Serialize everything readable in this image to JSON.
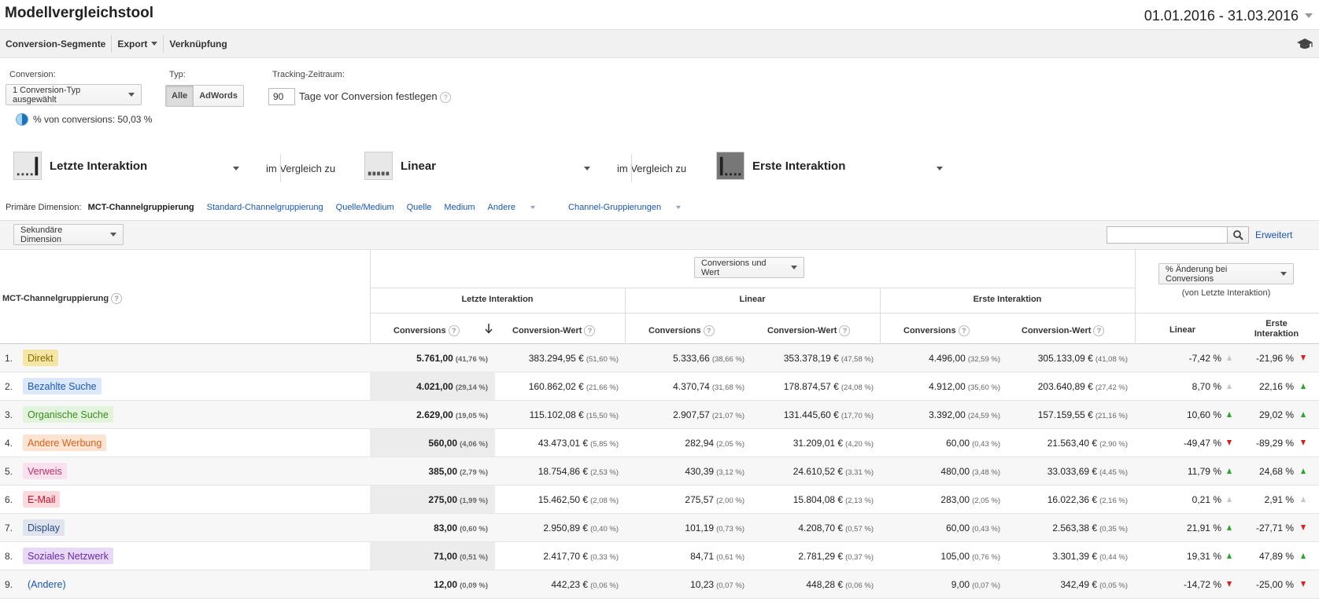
{
  "title": "Modellvergleichstool",
  "date_range": "01.01.2016 - 31.03.2016",
  "toolbar": {
    "segments": "Conversion-Segmente",
    "export": "Export",
    "link": "Verknüpfung"
  },
  "controls": {
    "conversion_label": "Conversion:",
    "conversion_value": "1 Conversion-Typ ausgewählt",
    "type_label": "Typ:",
    "type_all": "Alle",
    "type_adwords": "AdWords",
    "tracking_label": "Tracking-Zeitraum:",
    "days": "90",
    "days_text": "Tage vor Conversion festlegen",
    "pct_text": "% von conversions: 50,03 %"
  },
  "models": {
    "m1": "Letzte Interaktion",
    "m2": "Linear",
    "m3": "Erste Interaktion",
    "compare": "im Vergleich zu"
  },
  "dimensions": {
    "label": "Primäre Dimension:",
    "current": "MCT-Channelgruppierung",
    "standard": "Standard-Channelgruppierung",
    "source_medium": "Quelle/Medium",
    "source": "Quelle",
    "medium": "Medium",
    "other": "Andere",
    "channel_groups": "Channel-Gruppierungen"
  },
  "secondary_dimension": "Sekundäre Dimension",
  "advanced": "Erweitert",
  "table_header": {
    "dimension": "MCT-Channelgruppierung",
    "metric_select": "Conversions und Wert",
    "change_select": "% Änderung bei Conversions",
    "change_sub": "(von Letzte Interaktion)",
    "g1": "Letzte Interaktion",
    "g2": "Linear",
    "g3": "Erste Interaktion",
    "conversions": "Conversions",
    "value": "Conversion-Wert",
    "c_linear": "Linear",
    "c_first": "Erste Interaktion"
  },
  "rows": [
    {
      "n": "1.",
      "name": "Direkt",
      "bg": "#f5e6a6",
      "fg": "#8a6d00",
      "c1": "5.761,00",
      "p1": "(41,76 %)",
      "v1": "383.294,95 €",
      "q1": "(51,60 %)",
      "c2": "5.333,66",
      "p2": "(38,66 %)",
      "v2": "353.378,19 €",
      "q2": "(47,58 %)",
      "c3": "4.496,00",
      "p3": "(32,59 %)",
      "v3": "305.133,09 €",
      "q3": "(41,08 %)",
      "d1": "-7,42 %",
      "a1": "neutral",
      "d2": "-21,96 %",
      "a2": "down"
    },
    {
      "n": "2.",
      "name": "Bezahlte Suche",
      "bg": "#dbe8fb",
      "fg": "#1a56b8",
      "c1": "4.021,00",
      "p1": "(29,14 %)",
      "v1": "160.862,02 €",
      "q1": "(21,66 %)",
      "c2": "4.370,74",
      "p2": "(31,68 %)",
      "v2": "178.874,57 €",
      "q2": "(24,08 %)",
      "c3": "4.912,00",
      "p3": "(35,60 %)",
      "v3": "203.640,89 €",
      "q3": "(27,42 %)",
      "d1": "8,70 %",
      "a1": "neutral",
      "d2": "22,16 %",
      "a2": "up"
    },
    {
      "n": "3.",
      "name": "Organische Suche",
      "bg": "#e3f4dc",
      "fg": "#3a8a21",
      "c1": "2.629,00",
      "p1": "(19,05 %)",
      "v1": "115.102,08 €",
      "q1": "(15,50 %)",
      "c2": "2.907,57",
      "p2": "(21,07 %)",
      "v2": "131.445,60 €",
      "q2": "(17,70 %)",
      "c3": "3.392,00",
      "p3": "(24,59 %)",
      "v3": "157.159,55 €",
      "q3": "(21,16 %)",
      "d1": "10,60 %",
      "a1": "up",
      "d2": "29,02 %",
      "a2": "up"
    },
    {
      "n": "4.",
      "name": "Andere Werbung",
      "bg": "#fde4d2",
      "fg": "#d9621c",
      "c1": "560,00",
      "p1": "(4,06 %)",
      "v1": "43.473,01 €",
      "q1": "(5,85 %)",
      "c2": "282,94",
      "p2": "(2,05 %)",
      "v2": "31.209,01 €",
      "q2": "(4,20 %)",
      "c3": "60,00",
      "p3": "(0,43 %)",
      "v3": "21.563,40 €",
      "q3": "(2,90 %)",
      "d1": "-49,47 %",
      "a1": "down",
      "d2": "-89,29 %",
      "a2": "down"
    },
    {
      "n": "5.",
      "name": "Verweis",
      "bg": "#fbe1ee",
      "fg": "#b0326a",
      "c1": "385,00",
      "p1": "(2,79 %)",
      "v1": "18.754,86 €",
      "q1": "(2,53 %)",
      "c2": "430,39",
      "p2": "(3,12 %)",
      "v2": "24.610,52 €",
      "q2": "(3,31 %)",
      "c3": "480,00",
      "p3": "(3,48 %)",
      "v3": "33.033,69 €",
      "q3": "(4,45 %)",
      "d1": "11,79 %",
      "a1": "up",
      "d2": "24,68 %",
      "a2": "up"
    },
    {
      "n": "6.",
      "name": "E-Mail",
      "bg": "#fbd9dc",
      "fg": "#c8102e",
      "c1": "275,00",
      "p1": "(1,99 %)",
      "v1": "15.462,50 €",
      "q1": "(2,08 %)",
      "c2": "275,57",
      "p2": "(2,00 %)",
      "v2": "15.804,08 €",
      "q2": "(2,13 %)",
      "c3": "283,00",
      "p3": "(2,05 %)",
      "v3": "16.022,36 €",
      "q3": "(2,16 %)",
      "d1": "0,21 %",
      "a1": "neutral",
      "d2": "2,91 %",
      "a2": "neutral"
    },
    {
      "n": "7.",
      "name": "Display",
      "bg": "#dfe4ef",
      "fg": "#2c4a86",
      "c1": "83,00",
      "p1": "(0,60 %)",
      "v1": "2.950,89 €",
      "q1": "(0,40 %)",
      "c2": "101,19",
      "p2": "(0,73 %)",
      "v2": "4.208,70 €",
      "q2": "(0,57 %)",
      "c3": "60,00",
      "p3": "(0,43 %)",
      "v3": "2.563,38 €",
      "q3": "(0,35 %)",
      "d1": "21,91 %",
      "a1": "up",
      "d2": "-27,71 %",
      "a2": "down"
    },
    {
      "n": "8.",
      "name": "Soziales Netzwerk",
      "bg": "#e8d9f7",
      "fg": "#6a2ca6",
      "c1": "71,00",
      "p1": "(0,51 %)",
      "v1": "2.417,70 €",
      "q1": "(0,33 %)",
      "c2": "84,71",
      "p2": "(0,61 %)",
      "v2": "2.781,29 €",
      "q2": "(0,37 %)",
      "c3": "105,00",
      "p3": "(0,76 %)",
      "v3": "3.301,39 €",
      "q3": "(0,44 %)",
      "d1": "19,31 %",
      "a1": "up",
      "d2": "47,89 %",
      "a2": "up"
    },
    {
      "n": "9.",
      "name": "(Andere)",
      "bg": "transparent",
      "fg": "#1a56b8",
      "c1": "12,00",
      "p1": "(0,09 %)",
      "v1": "442,23 €",
      "q1": "(0,06 %)",
      "c2": "10,23",
      "p2": "(0,07 %)",
      "v2": "448,28 €",
      "q2": "(0,06 %)",
      "c3": "9,00",
      "p3": "(0,07 %)",
      "v3": "342,49 €",
      "q3": "(0,05 %)",
      "d1": "-14,72 %",
      "a1": "down",
      "d2": "-25,00 %",
      "a2": "down"
    }
  ]
}
